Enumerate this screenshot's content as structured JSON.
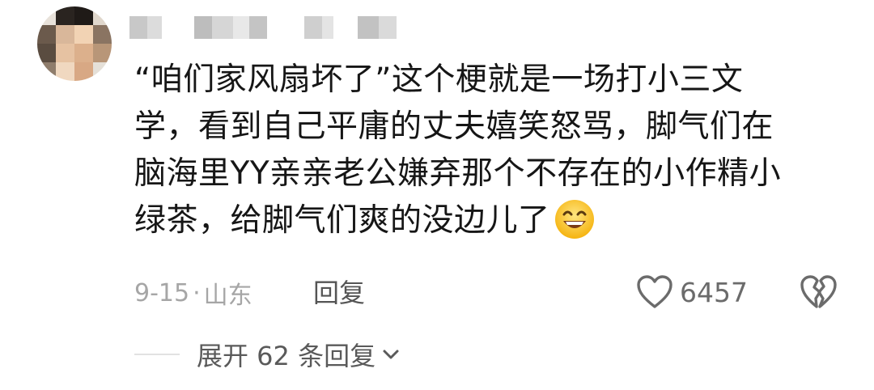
{
  "comment": {
    "text_lines": [
      "“咱们家风扇坏了”这个梗就是一场打小三文",
      "学，看到自己平庸的丈夫嬉笑怒骂，脚气们在",
      "脑海里YY亲亲老公嫌弃那个不存在的小作精小",
      "绿茶，给脚气们爽的没边儿了"
    ],
    "emoji": "grinning-face-emoji",
    "date": "9-15",
    "separator": "·",
    "location": "山东",
    "reply_label": "回复",
    "like_count": "6457",
    "expand_label": "展开 62 条回复"
  },
  "icons": {
    "like": "heart-outline-icon",
    "dislike": "broken-heart-icon",
    "expand": "chevron-down-icon"
  },
  "colors": {
    "text": "#161616",
    "meta": "#a6a6a6",
    "action": "#555555"
  }
}
